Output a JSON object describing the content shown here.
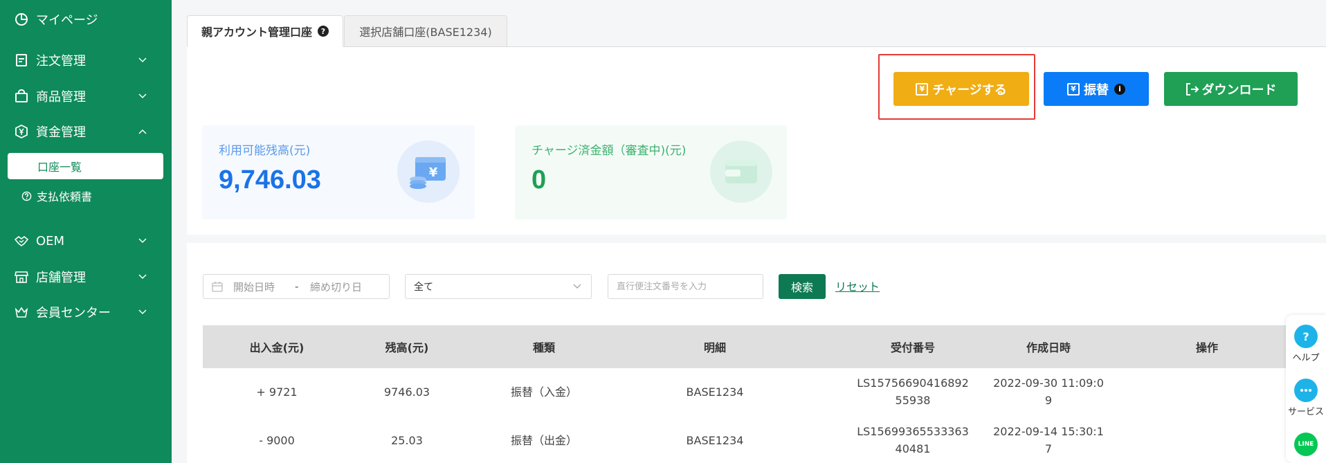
{
  "sidebar": {
    "items": [
      {
        "label": "マイページ"
      },
      {
        "label": "注文管理"
      },
      {
        "label": "商品管理"
      },
      {
        "label": "資金管理"
      },
      {
        "label": "OEM"
      },
      {
        "label": "店舗管理"
      },
      {
        "label": "会員センター"
      }
    ],
    "sub_items": [
      {
        "label": "口座一覧"
      },
      {
        "label": "支払依頼書"
      }
    ]
  },
  "tabs": [
    {
      "label": "親アカウント管理口座"
    },
    {
      "label": "選択店舗口座(BASE1234)"
    }
  ],
  "actions": {
    "charge_label": "チャージする",
    "transfer_label": "振替",
    "download_label": "ダウンロード"
  },
  "cards": {
    "available": {
      "title": "利用可能残高(元)",
      "value": "9,746.03",
      "color": "#1a73e8"
    },
    "charged": {
      "title": "チャージ済金額（審査中)(元)",
      "value": "0",
      "color": "#1fa055"
    }
  },
  "filters": {
    "start_placeholder": "開始日時",
    "separator": "-",
    "end_placeholder": "締め切り日",
    "type_value": "全て",
    "order_placeholder": "直行便注文番号を入力",
    "search_label": "検索",
    "reset_label": "リセット"
  },
  "table": {
    "headers": [
      "出入金(元)",
      "残高(元)",
      "種類",
      "明細",
      "受付番号",
      "作成日時",
      "操作"
    ],
    "rows": [
      {
        "amount": "+ 9721",
        "balance": "9746.03",
        "type": "振替（入金）",
        "detail": "BASE1234",
        "receipt": "LS1575669041689255938",
        "created": "2022-09-30 11:09:09",
        "op": ""
      },
      {
        "amount": "- 9000",
        "balance": "25.03",
        "type": "振替（出金）",
        "detail": "BASE1234",
        "receipt": "LS1569936553336340481",
        "created": "2022-09-14 15:30:17",
        "op": ""
      }
    ]
  },
  "float_widgets": [
    {
      "label": "ヘルプ"
    },
    {
      "label": "サービス"
    },
    {
      "label": "LINE"
    }
  ],
  "colors": {
    "sidebar_bg": "#0f8a5a",
    "charge_btn": "#f0ad14",
    "transfer_btn": "#0a7cf7",
    "download_btn": "#1fa055",
    "search_btn": "#0d7a53",
    "highlight_border": "#e53935"
  },
  "icons": {
    "mypage": "pie-chart-icon",
    "orders": "document-icon",
    "products": "shopping-bag-icon",
    "funds": "yen-icon",
    "oem": "handshake-icon",
    "store": "store-icon",
    "member": "crown-icon"
  }
}
